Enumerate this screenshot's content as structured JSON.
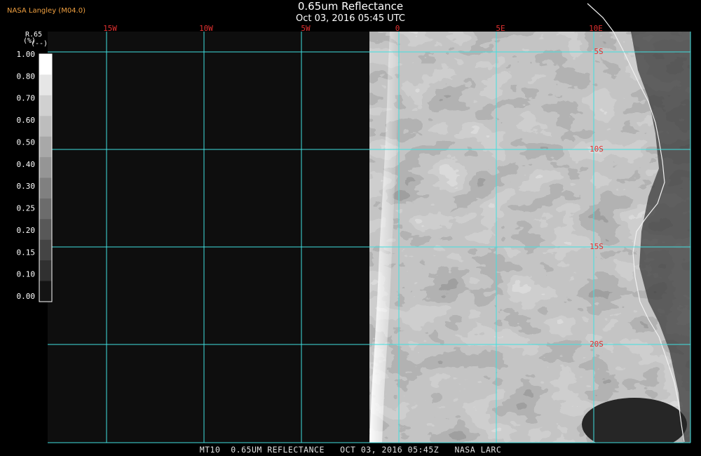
{
  "header": {
    "organization": "NASA Langley (M04.0)",
    "title": "0.65um Reflectance",
    "timestamp": "Oct 03, 2016 05:45 UTC"
  },
  "legend": {
    "variable": "R.65",
    "unit": "(%)",
    "sub": "(--)",
    "ticks": [
      "1.00",
      "0.80",
      "0.70",
      "0.60",
      "0.50",
      "0.40",
      "0.30",
      "0.25",
      "0.20",
      "0.15",
      "0.10",
      "0.00"
    ],
    "colors": [
      "#ffffff",
      "#e6e6e6",
      "#d0d0d0",
      "#bdbdbd",
      "#a8a8a8",
      "#959595",
      "#808080",
      "#6c6c6c",
      "#585858",
      "#444444",
      "#303030",
      "#141414"
    ]
  },
  "gridlines": {
    "longitude_labels": [
      "15W",
      "10W",
      "5W",
      "0",
      "5E",
      "10E"
    ],
    "latitude_labels": [
      "5S",
      "10S",
      "15S",
      "20S"
    ],
    "grid_color": "#40e0e0",
    "label_color": "#e03030"
  },
  "footer": {
    "text": "MT10  0.65UM REFLECTANCE   OCT 03, 2016 05:45Z   NASA LARC"
  }
}
